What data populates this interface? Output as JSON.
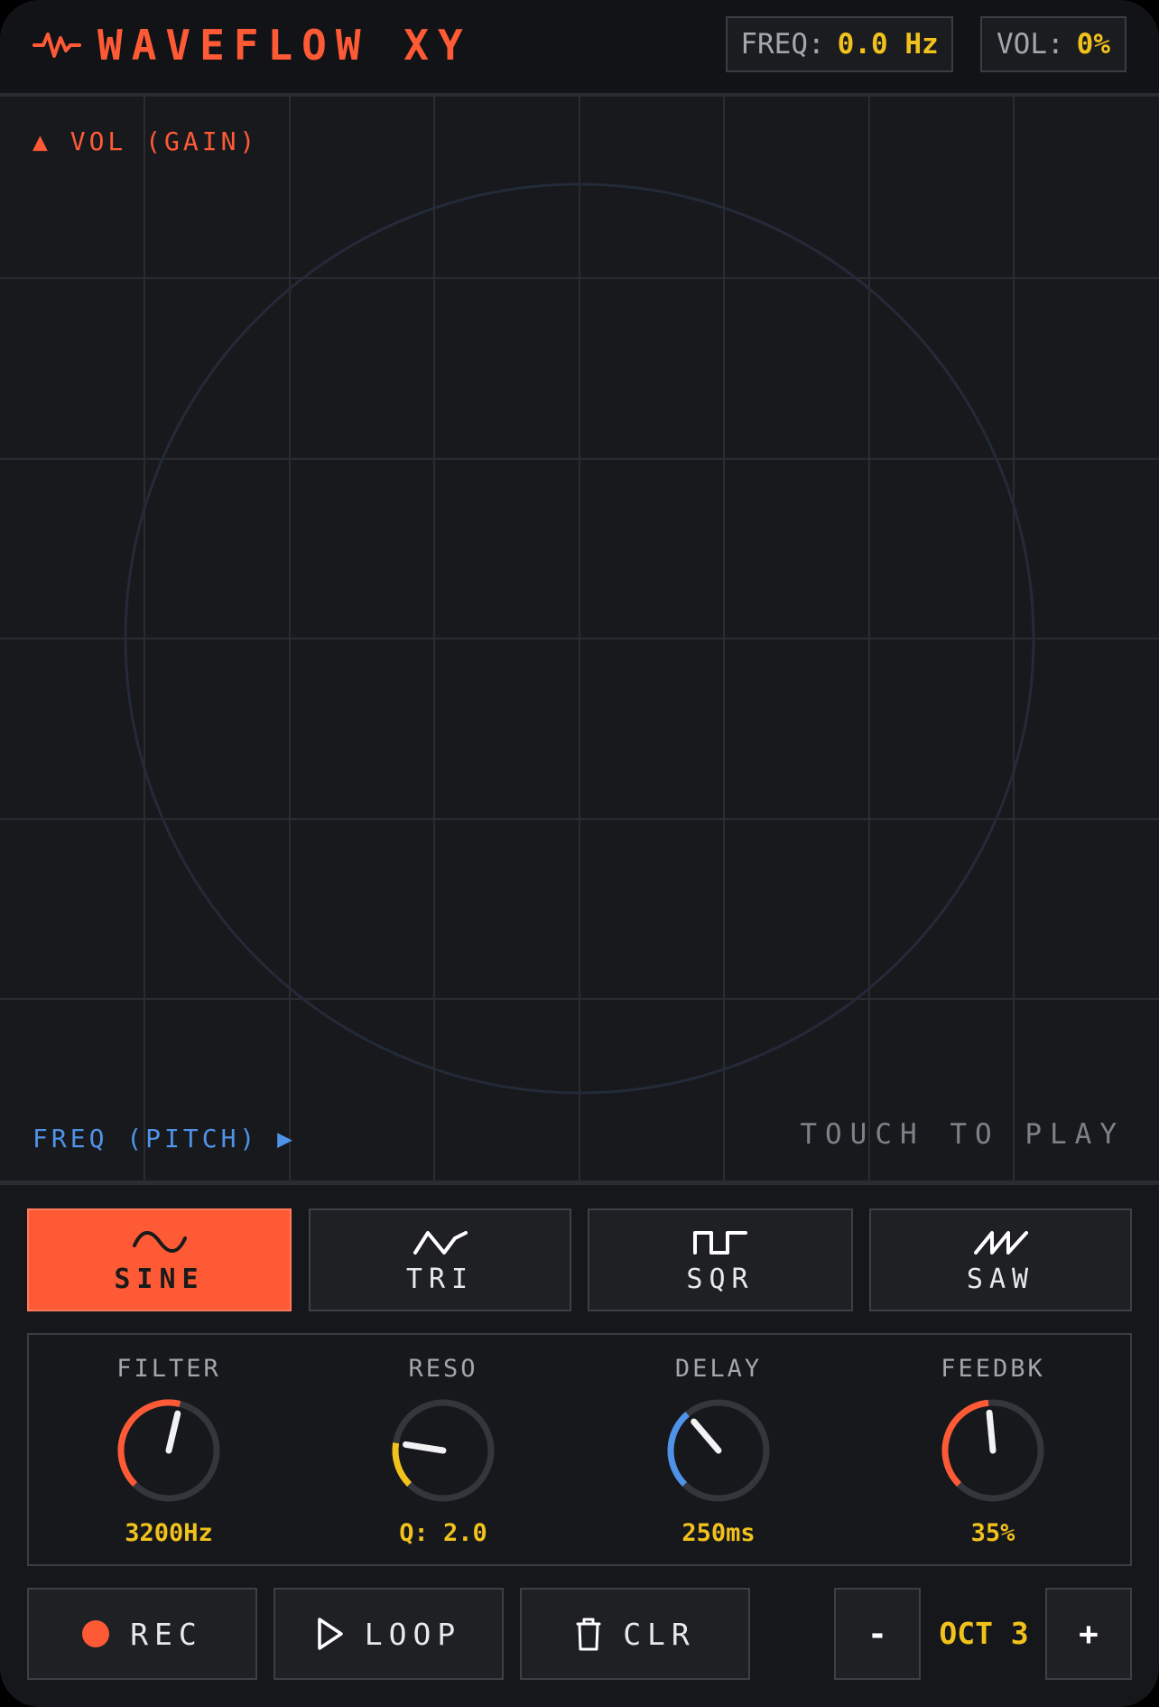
{
  "header": {
    "title": "WAVEFLOW XY",
    "freq_label": "FREQ:",
    "freq_value": "0.0 Hz",
    "vol_label": "VOL:",
    "vol_value": "0%"
  },
  "pad": {
    "y_axis_label": "▲ VOL (GAIN)",
    "x_axis_label": "FREQ (PITCH) ▶",
    "hint": "TOUCH TO PLAY"
  },
  "waveforms": [
    {
      "label": "SINE",
      "icon": "sine-wave-icon",
      "active": true
    },
    {
      "label": "TRI",
      "icon": "triangle-wave-icon",
      "active": false
    },
    {
      "label": "SQR",
      "icon": "square-wave-icon",
      "active": false
    },
    {
      "label": "SAW",
      "icon": "sawtooth-wave-icon",
      "active": false
    }
  ],
  "knobs": [
    {
      "label": "FILTER",
      "value": "3200Hz",
      "level": 0.55,
      "color": "#ff5a36"
    },
    {
      "label": "RESO",
      "value": "Q: 2.0",
      "level": 0.2,
      "color": "#f2c21c"
    },
    {
      "label": "DELAY",
      "value": "250ms",
      "level": 0.35,
      "color": "#4f93e8"
    },
    {
      "label": "FEEDBK",
      "value": "35%",
      "level": 0.48,
      "color": "#ff5a36"
    }
  ],
  "controls": {
    "rec_label": "REC",
    "loop_label": "LOOP",
    "clear_label": "CLR",
    "octave_down_label": "-",
    "octave_up_label": "+",
    "octave_label": "OCT 3"
  },
  "colors": {
    "accent": "#ff5a36",
    "value_yellow": "#f2c21c",
    "freq_blue": "#4f93e8",
    "background": "#16171b"
  }
}
